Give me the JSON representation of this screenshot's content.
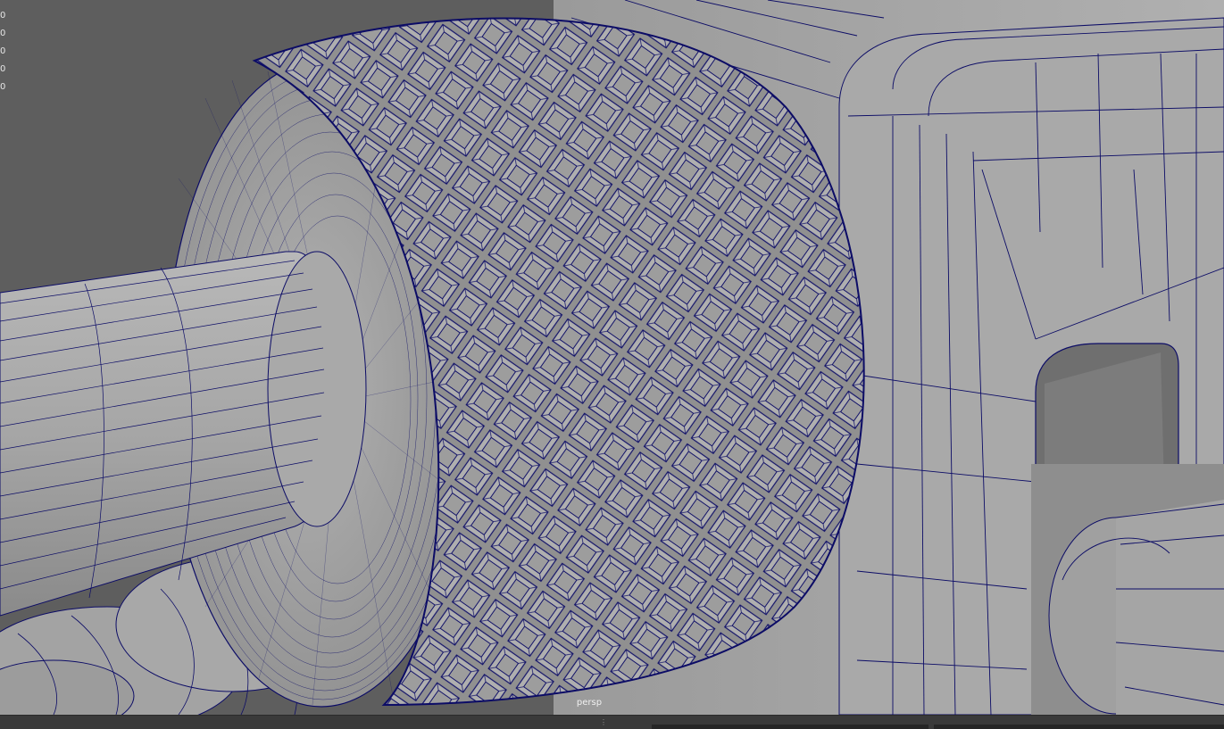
{
  "viewport": {
    "camera_label": "persp",
    "hud_values": [
      "0",
      "0",
      "0",
      "0",
      "0"
    ]
  },
  "colors": {
    "background": "#5e5e5e",
    "mesh_fill": "#a2a2a2",
    "wire": "#0c0c66"
  },
  "icons": {
    "panel_handle": "drag-handle-icon"
  }
}
